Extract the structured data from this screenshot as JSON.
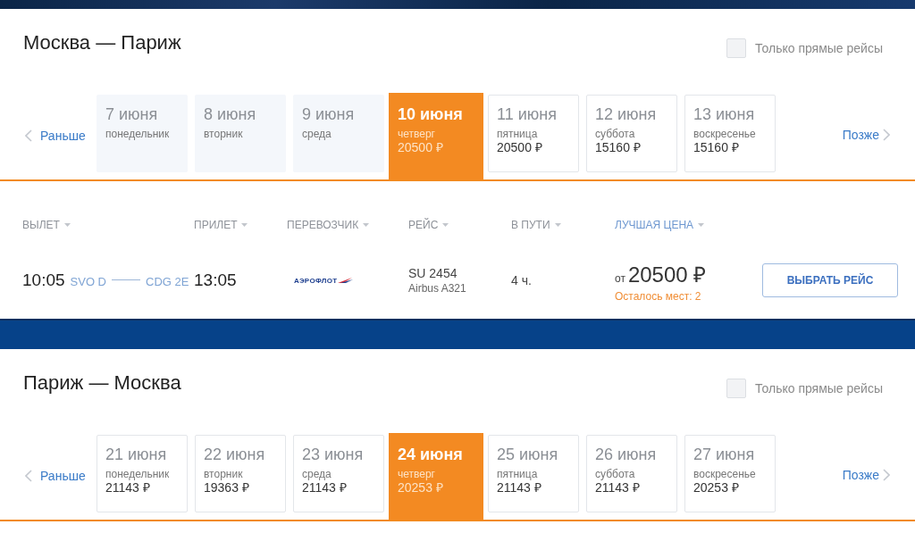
{
  "routes": [
    {
      "title": "Москва — Париж",
      "direct_only": {
        "label": "Только прямые рейсы",
        "checked": false
      },
      "earlier": "Раньше",
      "later": "Позже",
      "dates": [
        {
          "date": "7 июня",
          "weekday": "понедельник",
          "available": false,
          "selected": false
        },
        {
          "date": "8 июня",
          "weekday": "вторник",
          "available": false,
          "selected": false
        },
        {
          "date": "9 июня",
          "weekday": "среда",
          "available": false,
          "selected": false
        },
        {
          "date": "10 июня",
          "weekday": "четверг",
          "price": "20500 ₽",
          "available": true,
          "selected": true
        },
        {
          "date": "11 июня",
          "weekday": "пятница",
          "price": "20500 ₽",
          "available": true,
          "selected": false
        },
        {
          "date": "12 июня",
          "weekday": "суббота",
          "price": "15160 ₽",
          "available": true,
          "selected": false
        },
        {
          "date": "13 июня",
          "weekday": "воскресенье",
          "price": "15160 ₽",
          "available": true,
          "selected": false
        }
      ],
      "flights_table": {
        "columns": [
          {
            "label": "ВЫЛЕТ",
            "sorted": false
          },
          {
            "label": "ПРИЛЕТ",
            "sorted": false
          },
          {
            "label": "ПЕРЕВОЗЧИК",
            "sorted": false
          },
          {
            "label": "РЕЙС",
            "sorted": false
          },
          {
            "label": "В ПУТИ",
            "sorted": false
          },
          {
            "label": "ЛУЧШАЯ ЦЕНА",
            "sorted": true
          }
        ],
        "flights": [
          {
            "departure_time": "10:05",
            "departure_airport": "SVO D",
            "arrival_airport": "CDG 2E",
            "arrival_time": "13:05",
            "carrier_logo_text": "АЭРОФЛОТ",
            "flight_number": "SU 2454",
            "aircraft": "Airbus A321",
            "duration": "4 ч.",
            "price_prefix": "от",
            "price": "20500 ₽",
            "seats_left": "Осталось мест: 2",
            "select_button": "ВЫБРАТЬ РЕЙС"
          }
        ]
      }
    },
    {
      "title": "Париж — Москва",
      "direct_only": {
        "label": "Только прямые рейсы",
        "checked": false
      },
      "earlier": "Раньше",
      "later": "Позже",
      "dates": [
        {
          "date": "21 июня",
          "weekday": "понедельник",
          "price": "21143 ₽",
          "available": true,
          "selected": false
        },
        {
          "date": "22 июня",
          "weekday": "вторник",
          "price": "19363 ₽",
          "available": true,
          "selected": false
        },
        {
          "date": "23 июня",
          "weekday": "среда",
          "price": "21143 ₽",
          "available": true,
          "selected": false
        },
        {
          "date": "24 июня",
          "weekday": "четверг",
          "price": "20253 ₽",
          "available": true,
          "selected": true
        },
        {
          "date": "25 июня",
          "weekday": "пятница",
          "price": "21143 ₽",
          "available": true,
          "selected": false
        },
        {
          "date": "26 июня",
          "weekday": "суббота",
          "price": "21143 ₽",
          "available": true,
          "selected": false
        },
        {
          "date": "27 июня",
          "weekday": "воскресенье",
          "price": "20253 ₽",
          "available": true,
          "selected": false
        }
      ]
    }
  ]
}
